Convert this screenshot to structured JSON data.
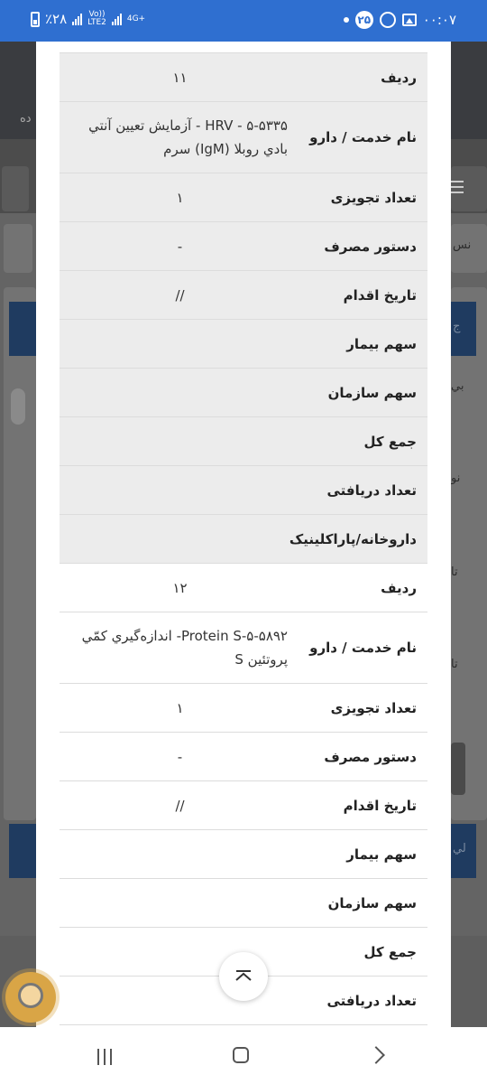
{
  "status_bar": {
    "time": "۰۰:۰۷",
    "battery_percent": "٪۲۸",
    "network_volte": "Vo))",
    "network_lte": "LTE2",
    "network_type": "4G+",
    "notification_badge": "۲۵",
    "bar_color": "#2f6fd0"
  },
  "records": [
    {
      "fields": [
        {
          "label": "رديف",
          "value": "۱۱"
        },
        {
          "label": "نام خدمت / دارو",
          "value": "۵-۵۳۳۵ - HRV - آزمايش تعيين آنتي بادي روبلا (IgM) سرم"
        },
        {
          "label": "تعداد تجويزى",
          "value": "۱"
        },
        {
          "label": "دستور مصرف",
          "value": "-"
        },
        {
          "label": "تاريخ اقدام",
          "value": "//"
        },
        {
          "label": "سهم بيمار",
          "value": ""
        },
        {
          "label": "سهم سازمان",
          "value": ""
        },
        {
          "label": "جمع كل",
          "value": ""
        },
        {
          "label": "تعداد دريافتى",
          "value": ""
        },
        {
          "label": "داروخانه/پاراكلينيک",
          "value": ""
        }
      ]
    },
    {
      "fields": [
        {
          "label": "رديف",
          "value": "۱۲"
        },
        {
          "label": "نام خدمت / دارو",
          "value": "۵-۵۸۹۲-Protein S- اندازه‌گيري كمّي پروتئين S"
        },
        {
          "label": "تعداد تجويزى",
          "value": "۱"
        },
        {
          "label": "دستور مصرف",
          "value": "-"
        },
        {
          "label": "تاريخ اقدام",
          "value": "//"
        },
        {
          "label": "سهم بيمار",
          "value": ""
        },
        {
          "label": "سهم سازمان",
          "value": ""
        },
        {
          "label": "جمع كل",
          "value": ""
        },
        {
          "label": "تعداد دريافتى",
          "value": ""
        }
      ]
    }
  ],
  "background_page": {
    "header_partial_text": "ده",
    "edge_texts": [
      "نس",
      "ج",
      "بي",
      "نو",
      "تا",
      "تا",
      "لي"
    ]
  },
  "icons": {
    "scroll_top": "chevron-up-icon",
    "recent_apps": "recent-apps-icon",
    "home": "home-icon",
    "back": "back-icon",
    "assistant": "support-avatar-icon"
  }
}
